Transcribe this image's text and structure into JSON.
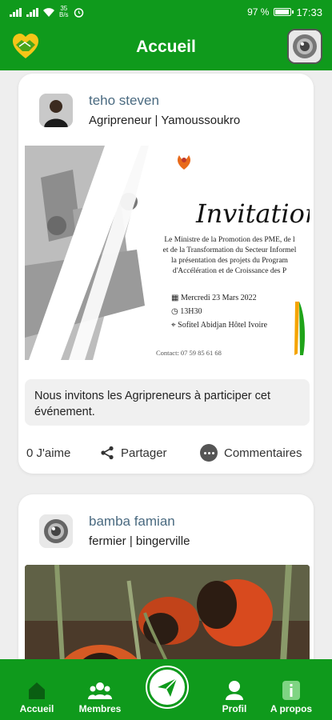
{
  "status_bar": {
    "network_speed_value": "35",
    "network_speed_unit": "B/s",
    "battery_percent": "97 %",
    "battery_level": 0.97,
    "time": "17:33"
  },
  "app_bar": {
    "title": "Accueil"
  },
  "posts": [
    {
      "author": "teho steven",
      "subtitle": "Agripreneur | Yamoussoukro",
      "image": {
        "heading": "Invitation",
        "lines": [
          "Le Ministre de la Promotion des PME, de l",
          "et de la Transformation du Secteur Informel",
          "la présentation des projets du Program",
          "d'Accélération et de Croissance des P"
        ],
        "date": "Mercredi 23 Mars 2022",
        "time": "13H30",
        "venue": "Sofitel Abidjan Hôtel Ivoire",
        "contact": "Contact: 07 59 85 61 68"
      },
      "caption": "Nous invitons les Agripreneurs à participer cet événement.",
      "likes": "0 J'aime",
      "share_label": "Partager",
      "comments_label": "Commentaires"
    },
    {
      "author": "bamba famian",
      "subtitle": "fermier | bingerville"
    }
  ],
  "bottom_nav": {
    "items": [
      {
        "label": "Accueil",
        "icon": "home-icon"
      },
      {
        "label": "Membres",
        "icon": "members-icon"
      },
      {
        "label": "Profil",
        "icon": "profile-icon"
      },
      {
        "label": "A propos",
        "icon": "info-icon"
      }
    ],
    "center_icon": "send-icon"
  },
  "colors": {
    "primary_green": "#0f9a1c",
    "background": "#eeeeee",
    "author_name": "#4a6a80"
  }
}
